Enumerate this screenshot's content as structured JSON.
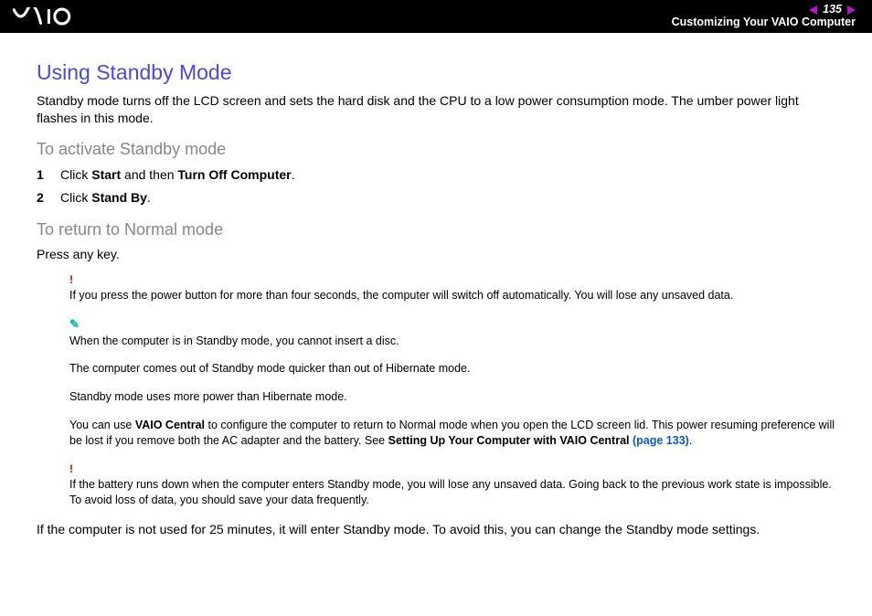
{
  "header": {
    "page_number": "135",
    "section": "Customizing Your VAIO Computer"
  },
  "title": "Using Standby Mode",
  "intro": "Standby mode turns off the LCD screen and sets the hard disk and the CPU to a low power consumption mode. The umber power light flashes in this mode.",
  "activate": {
    "heading": "To activate Standby mode",
    "steps": [
      {
        "num": "1",
        "pre": "Click ",
        "b1": "Start",
        "mid": " and then ",
        "b2": "Turn Off Computer",
        "post": "."
      },
      {
        "num": "2",
        "pre": "Click ",
        "b1": "Stand By",
        "mid": "",
        "b2": "",
        "post": "."
      }
    ]
  },
  "return": {
    "heading": "To return to Normal mode",
    "text": "Press any key."
  },
  "notes": {
    "warn1": "If you press the power button for more than four seconds, the computer will switch off automatically. You will lose any unsaved data.",
    "tip1": "When the computer is in Standby mode, you cannot insert a disc.",
    "tip2": "The computer comes out of Standby mode quicker than out of Hibernate mode.",
    "tip3": "Standby mode uses more power than Hibernate mode.",
    "tip4_pre": "You can use ",
    "tip4_b1": "VAIO Central",
    "tip4_mid": " to configure the computer to return to Normal mode when you open the LCD screen lid. This power resuming preference will be lost if you remove both the AC adapter and the battery. See ",
    "tip4_b2": "Setting Up Your Computer with VAIO Central",
    "tip4_link": " (page 133)",
    "tip4_post": ".",
    "warn2": "If the battery runs down when the computer enters Standby mode, you will lose any unsaved data. Going back to the previous work state is impossible. To avoid loss of data, you should save your data frequently."
  },
  "footer": "If the computer is not used for 25 minutes, it will enter Standby mode. To avoid this, you can change the Standby mode settings."
}
